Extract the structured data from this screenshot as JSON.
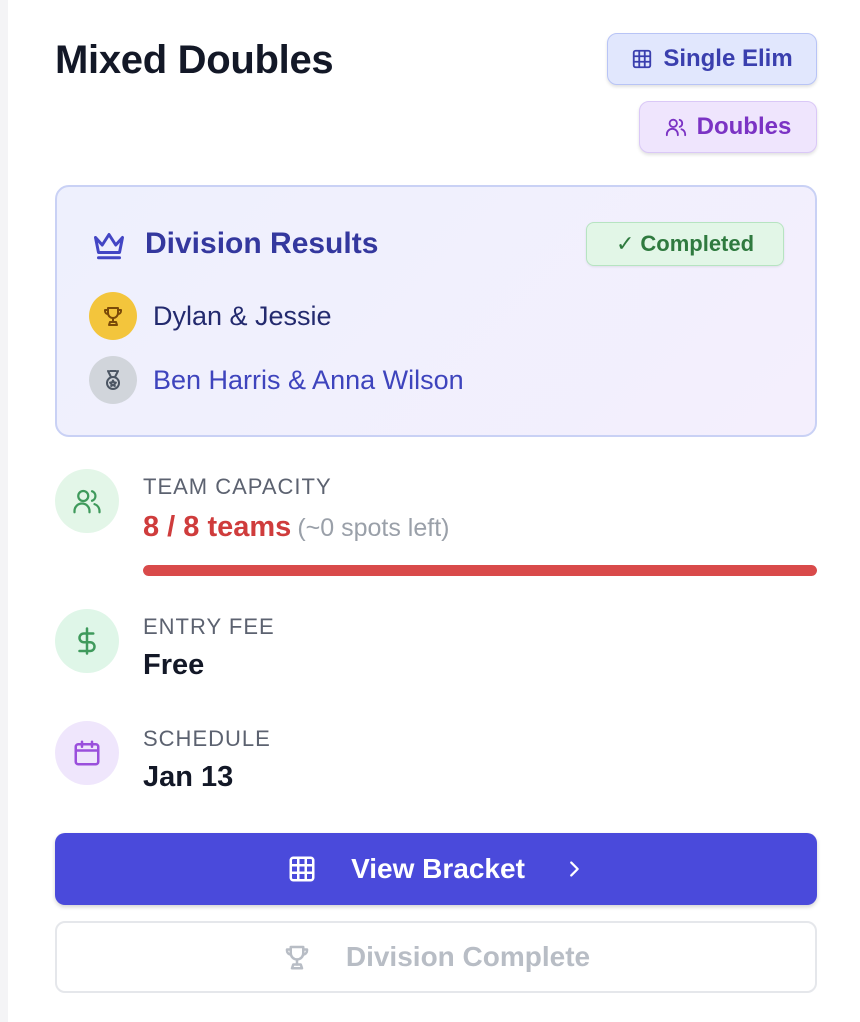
{
  "division": {
    "title": "Mixed Doubles",
    "format_label": "Single Elim",
    "type_label": "Doubles"
  },
  "results": {
    "heading": "Division Results",
    "status_check": "✓",
    "status_label": "Completed",
    "first_place": "Dylan & Jessie",
    "second_place": "Ben Harris & Anna Wilson"
  },
  "capacity": {
    "label": "TEAM CAPACITY",
    "value": "8 / 8 teams",
    "spots_left": "(~0 spots left)",
    "filled_fraction": 1.0
  },
  "entry_fee": {
    "label": "ENTRY FEE",
    "value": "Free"
  },
  "schedule": {
    "label": "SCHEDULE",
    "value": "Jan 13"
  },
  "actions": {
    "view_bracket": "View Bracket",
    "division_complete": "Division Complete"
  },
  "icons": {
    "format": "grid-icon",
    "type": "users-icon",
    "results": "crown-icon",
    "first": "trophy-icon",
    "second": "medal-icon",
    "capacity": "users-icon",
    "fee": "dollar-icon",
    "schedule": "calendar-icon",
    "bracket": "grid-icon",
    "chevron": "chevron-right-icon",
    "complete": "trophy-icon"
  },
  "colors": {
    "primary": "#4a4adb",
    "danger": "#cf3c3c",
    "success": "#2f7a3f",
    "gold": "#f3c53c",
    "silver": "#d1d5db"
  }
}
